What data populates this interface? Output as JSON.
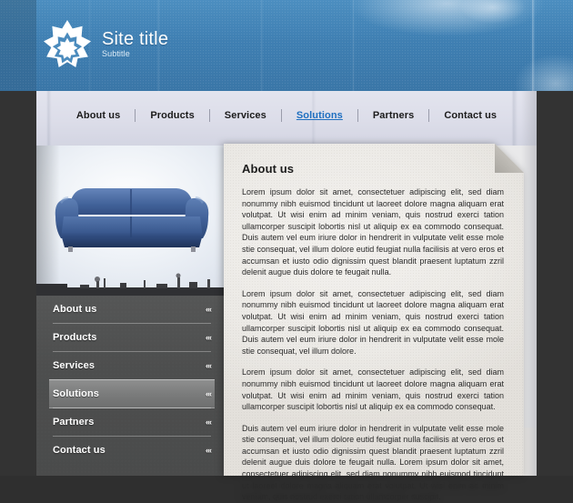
{
  "brand": {
    "logo_icon": "eight-point-star-icon",
    "title": "Site title",
    "subtitle": "Subtitle",
    "header_color": "#3f7fb2",
    "title_color": "#ffffff"
  },
  "topnav": {
    "items": [
      {
        "label": "About us",
        "active": false
      },
      {
        "label": "Products",
        "active": false
      },
      {
        "label": "Services",
        "active": false
      },
      {
        "label": "Solutions",
        "active": true
      },
      {
        "label": "Partners",
        "active": false
      },
      {
        "label": "Contact us",
        "active": false
      }
    ],
    "active_color": "#1f6fc0",
    "text_color": "#1b1b1b"
  },
  "hero": {
    "image_alt": "blue-sofa",
    "sofa_color": "#3f5f96"
  },
  "sidebar": {
    "chevron_glyph": "‹‹‹",
    "items": [
      {
        "label": "About us",
        "active": false
      },
      {
        "label": "Products",
        "active": false
      },
      {
        "label": "Services",
        "active": false
      },
      {
        "label": "Solutions",
        "active": true
      },
      {
        "label": "Partners",
        "active": false
      },
      {
        "label": "Contact us",
        "active": false
      }
    ],
    "background_color": "#4d4e4e",
    "active_background": "#7b7c7c"
  },
  "content": {
    "title": "About us",
    "paragraphs": [
      "Lorem ipsum dolor sit amet, consectetuer adipiscing elit, sed diam nonummy nibh euismod tincidunt ut laoreet dolore magna aliquam erat volutpat. Ut wisi enim ad minim veniam, quis nostrud exerci tation ullamcorper suscipit lobortis nisl ut aliquip ex ea commodo consequat. Duis autem vel eum iriure dolor in hendrerit in vulputate velit esse mole stie consequat, vel illum dolore eutid feugiat nulla facilisis at vero eros et accumsan et iusto odio dignissim quest blandit praesent luptatum zzril delenit augue duis dolore te feugait nulla.",
      "Lorem ipsum dolor sit amet, consectetuer adipiscing elit, sed diam nonummy nibh euismod tincidunt ut laoreet dolore magna aliquam erat volutpat. Ut wisi enim ad minim veniam, quis nostrud exerci tation ullamcorper suscipit lobortis nisl ut aliquip ex ea commodo consequat. Duis autem vel eum iriure dolor in hendrerit in vulputate velit esse mole stie consequat, vel illum dolore.",
      "Lorem ipsum dolor sit amet, consectetuer adipiscing elit, sed diam nonummy nibh euismod tincidunt ut laoreet dolore magna aliquam erat volutpat. Ut wisi enim ad minim veniam, quis nostrud exerci tation ullamcorper suscipit lobortis nisl ut aliquip ex ea commodo consequat.",
      "Duis autem vel eum iriure dolor in hendrerit in vulputate velit esse mole stie consequat, vel illum dolore eutid feugiat nulla facilisis at vero eros et accumsan et iusto odio dignissim quest blandit praesent luptatum zzril delenit augue duis dolore te feugait nulla. Lorem ipsum dolor sit amet, consectetuer adipiscing elit, sed diam nonummy nibh euismod tincidunt ut laoreet dolore magna aliquam erat volutpat. Ut wisi enim ad minim veniam, quis nostrud exerci tation ullamcorper suscipit."
    ]
  }
}
